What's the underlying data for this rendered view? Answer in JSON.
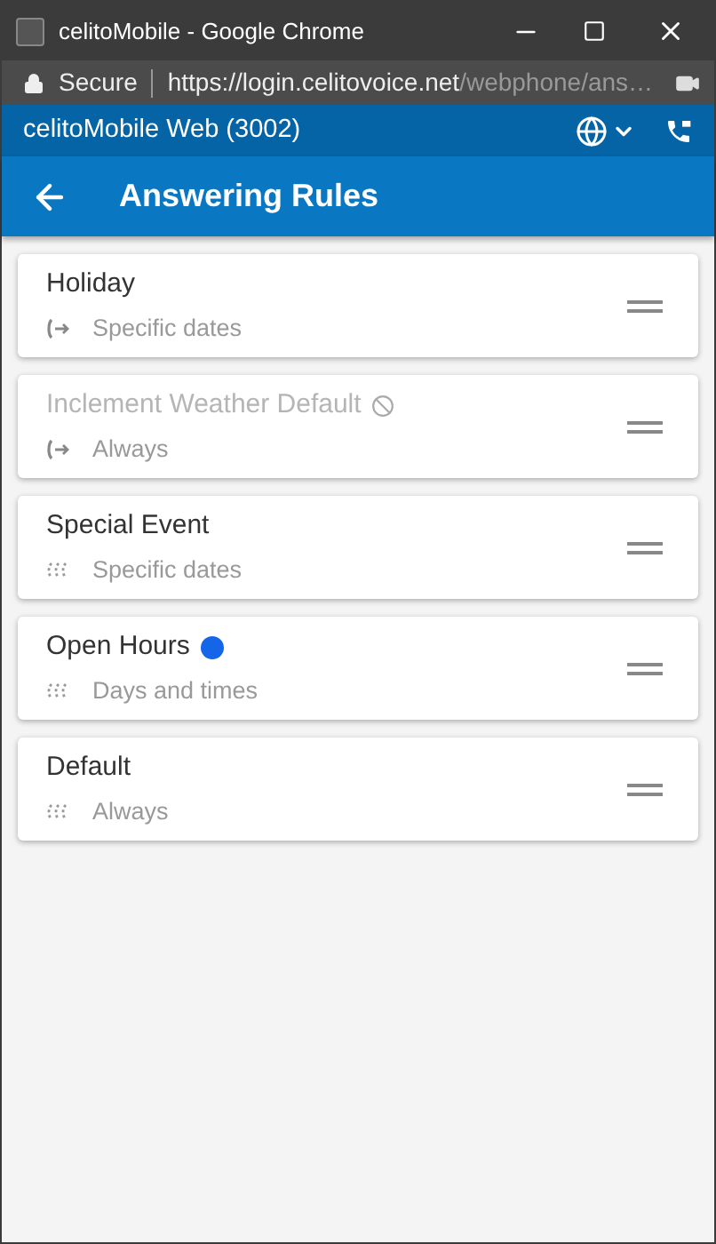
{
  "window": {
    "title": "celitoMobile - Google Chrome"
  },
  "address_bar": {
    "security": "Secure",
    "url_host": "https://login.celitovoice.net",
    "url_path": "/webphone/ans…"
  },
  "app_bar": {
    "title": "celitoMobile Web (3002)"
  },
  "header": {
    "title": "Answering Rules"
  },
  "rules": [
    {
      "name": "Holiday",
      "schedule": "Specific dates",
      "kind": "forward",
      "disabled": false,
      "active": false
    },
    {
      "name": "Inclement Weather Default",
      "schedule": "Always",
      "kind": "forward",
      "disabled": true,
      "active": false
    },
    {
      "name": "Special Event",
      "schedule": "Specific dates",
      "kind": "ring",
      "disabled": false,
      "active": false
    },
    {
      "name": "Open Hours",
      "schedule": "Days and times",
      "kind": "ring",
      "disabled": false,
      "active": true
    },
    {
      "name": "Default",
      "schedule": "Always",
      "kind": "ring",
      "disabled": false,
      "active": false
    }
  ]
}
